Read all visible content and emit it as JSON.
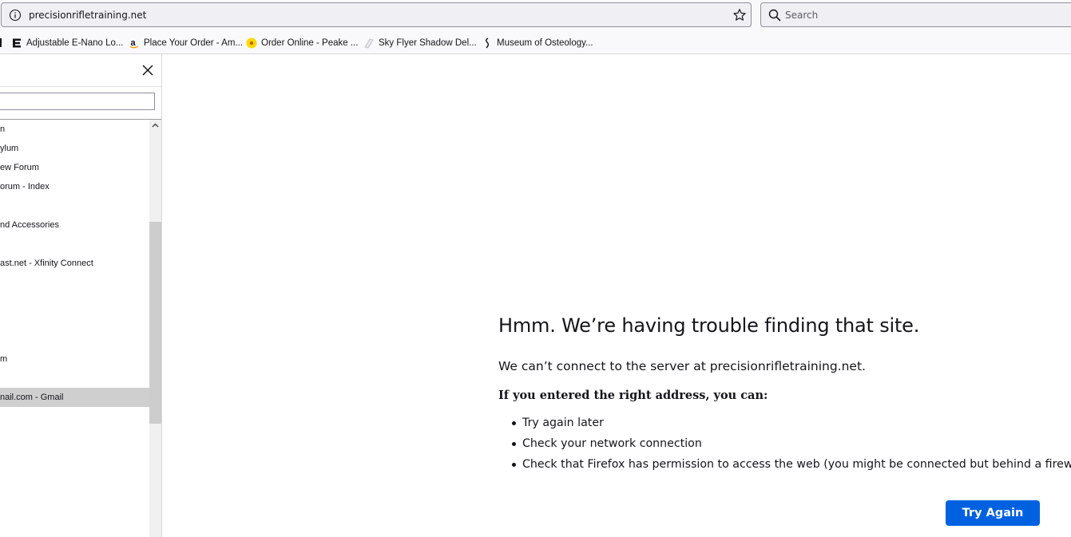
{
  "toolbar": {
    "url": "precisionrifletraining.net",
    "search_placeholder": "Search"
  },
  "bookmarks": [
    {
      "label": "Adjustable E-Nano Lo...",
      "icon": "e-logo-icon"
    },
    {
      "label": "Place Your Order - Am...",
      "icon": "amazon-icon"
    },
    {
      "label": "Order Online - Peake ...",
      "icon": "sun-icon"
    },
    {
      "label": "Sky Flyer Shadow Del...",
      "icon": "glider-icon"
    },
    {
      "label": "Museum of Osteology...",
      "icon": "spine-icon"
    }
  ],
  "sidebar": {
    "items": [
      {
        "label": "n"
      },
      {
        "label": "ylum"
      },
      {
        "label": "ew Forum"
      },
      {
        "label": "orum - Index"
      },
      {
        "label": ""
      },
      {
        "label": "nd Accessories"
      },
      {
        "label": ""
      },
      {
        "label": "ast.net - Xfinity Connect"
      },
      {
        "label": ""
      },
      {
        "label": ""
      },
      {
        "label": ""
      },
      {
        "label": ""
      },
      {
        "label": "m"
      },
      {
        "label": ""
      },
      {
        "label": "nail.com - Gmail",
        "selected": true
      }
    ]
  },
  "error": {
    "title": "Hmm. We’re having trouble finding that site.",
    "description": "We can’t connect to the server at precisionrifletraining.net.",
    "subheading": "If you entered the right address, you can:",
    "suggestions": [
      "Try again later",
      "Check your network connection",
      "Check that Firefox has permission to access the web (you might be connected but behind a firewall)"
    ],
    "button_label": "Try Again"
  },
  "colors": {
    "accent": "#0061e0",
    "selected_row": "#cfcfcf"
  }
}
